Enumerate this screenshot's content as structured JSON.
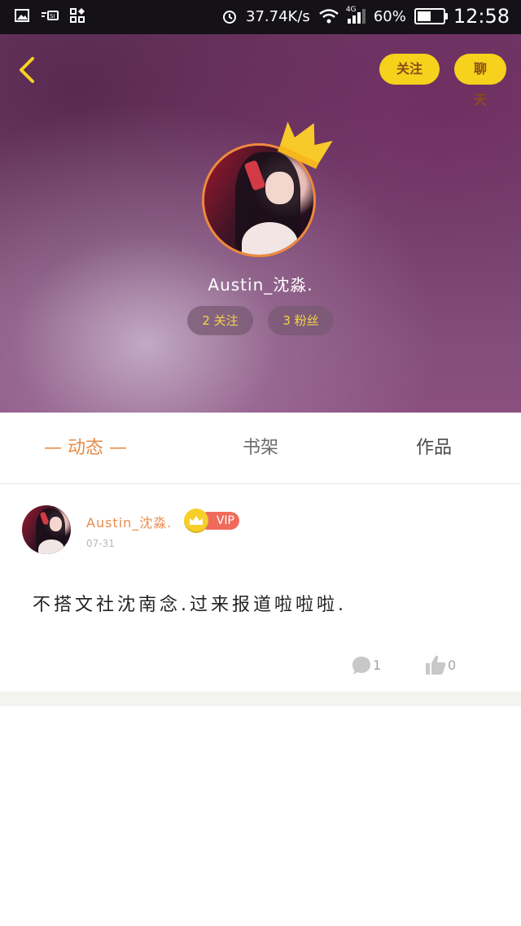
{
  "status_bar": {
    "left_icons": [
      "image-icon",
      "sim-icon",
      "apps-icon"
    ],
    "alarm_icon": "alarm-icon",
    "network_speed": "37.74K/s",
    "wifi_icon": "wifi-icon",
    "signal_label": "4G",
    "battery_percent_text": "60%",
    "battery_level": 0.6,
    "time": "12:58"
  },
  "header": {
    "back_icon": "back-chevron-icon",
    "follow_button": "关注",
    "chat_button": "聊天",
    "username": "Austin_沈淼.",
    "stats": {
      "following": "2 关注",
      "fans": "3 粉丝"
    },
    "crown_color": "#f7c92a",
    "accent_color": "#f6d21d"
  },
  "tabs": [
    {
      "label": "— 动态 —",
      "active": true
    },
    {
      "label": "书架",
      "active": false
    },
    {
      "label": "作品",
      "active": false
    }
  ],
  "post": {
    "author": "Austin_沈淼.",
    "vip_label": "VIP",
    "date": "07-31",
    "text": "不搭文社沈南念.过来报道啦啦啦.",
    "comment_count": "1",
    "like_count": "0"
  }
}
